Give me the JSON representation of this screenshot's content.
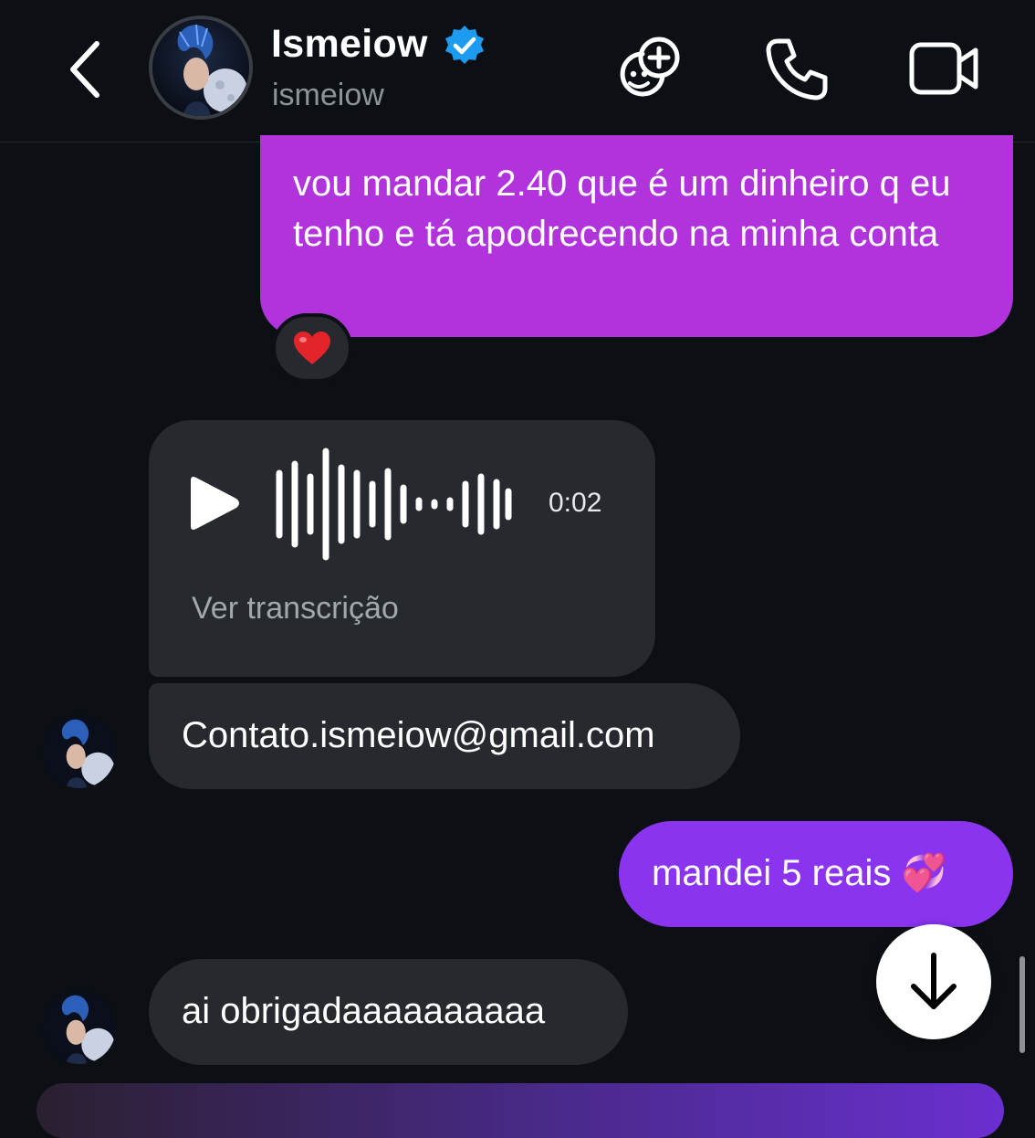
{
  "header": {
    "display_name": "Ismeiow",
    "username": "ismeiow",
    "verified": true,
    "back_icon": "chevron-left-icon",
    "actions": [
      {
        "icon": "game-invite-icon"
      },
      {
        "icon": "phone-icon"
      },
      {
        "icon": "video-camera-icon"
      }
    ]
  },
  "messages": [
    {
      "type": "text",
      "direction": "outgoing",
      "text": "vou mandar 2.40 que é um dinheiro q eu tenho e tá apodrecendo na minha conta",
      "reaction": "❤️",
      "bubble_color": "#b033dc"
    },
    {
      "type": "voice",
      "direction": "incoming",
      "duration": "0:02",
      "transcribe_label": "Ver transcrição"
    },
    {
      "type": "text",
      "direction": "incoming",
      "text": "Contato.ismeiow@gmail.com"
    },
    {
      "type": "text",
      "direction": "outgoing",
      "text": "mandei 5 reais 💞",
      "bubble_color": "#8a34f0"
    },
    {
      "type": "text",
      "direction": "incoming",
      "text": "ai obrigadaaaaaaaaaa"
    }
  ],
  "colors": {
    "background": "#0c1014",
    "incoming_bubble": "#262a2f",
    "verified_badge": "#1d9bf0"
  }
}
